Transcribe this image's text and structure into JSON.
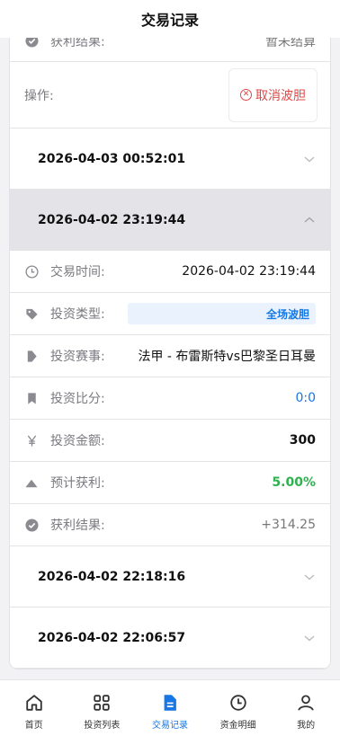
{
  "header": {
    "title": "交易记录"
  },
  "top_record": {
    "result_label": "获利结果:",
    "result_value": "暂未结算",
    "operation_label": "操作:",
    "cancel_label": "取消波胆"
  },
  "records": [
    {
      "datetime": "2026-04-03 00:52:01"
    },
    {
      "datetime": "2026-04-02 23:19:44"
    },
    {
      "datetime": "2026-04-02 22:18:16"
    },
    {
      "datetime": "2026-04-02 22:06:57"
    }
  ],
  "detail": {
    "time_label": "交易时间:",
    "time_value": "2026-04-02 23:19:44",
    "type_label": "投资类型:",
    "type_value": "全场波胆",
    "event_label": "投资赛事:",
    "event_value": "法甲 - 布雷斯特vs巴黎圣日耳曼",
    "score_label": "投资比分:",
    "score_value": "0:0",
    "amount_label": "投资金额:",
    "amount_value": "300",
    "profit_label": "预计获利:",
    "profit_value": "5.00%",
    "result_label": "获利结果:",
    "result_value": "+314.25"
  },
  "tabs": [
    {
      "label": "首页",
      "icon": "home-icon"
    },
    {
      "label": "投资列表",
      "icon": "grid-icon"
    },
    {
      "label": "交易记录",
      "icon": "document-icon"
    },
    {
      "label": "资金明细",
      "icon": "clock-icon"
    },
    {
      "label": "我的",
      "icon": "user-icon"
    }
  ],
  "colors": {
    "accent": "#1677e5",
    "danger": "#e04848",
    "success": "#2eb24e"
  }
}
